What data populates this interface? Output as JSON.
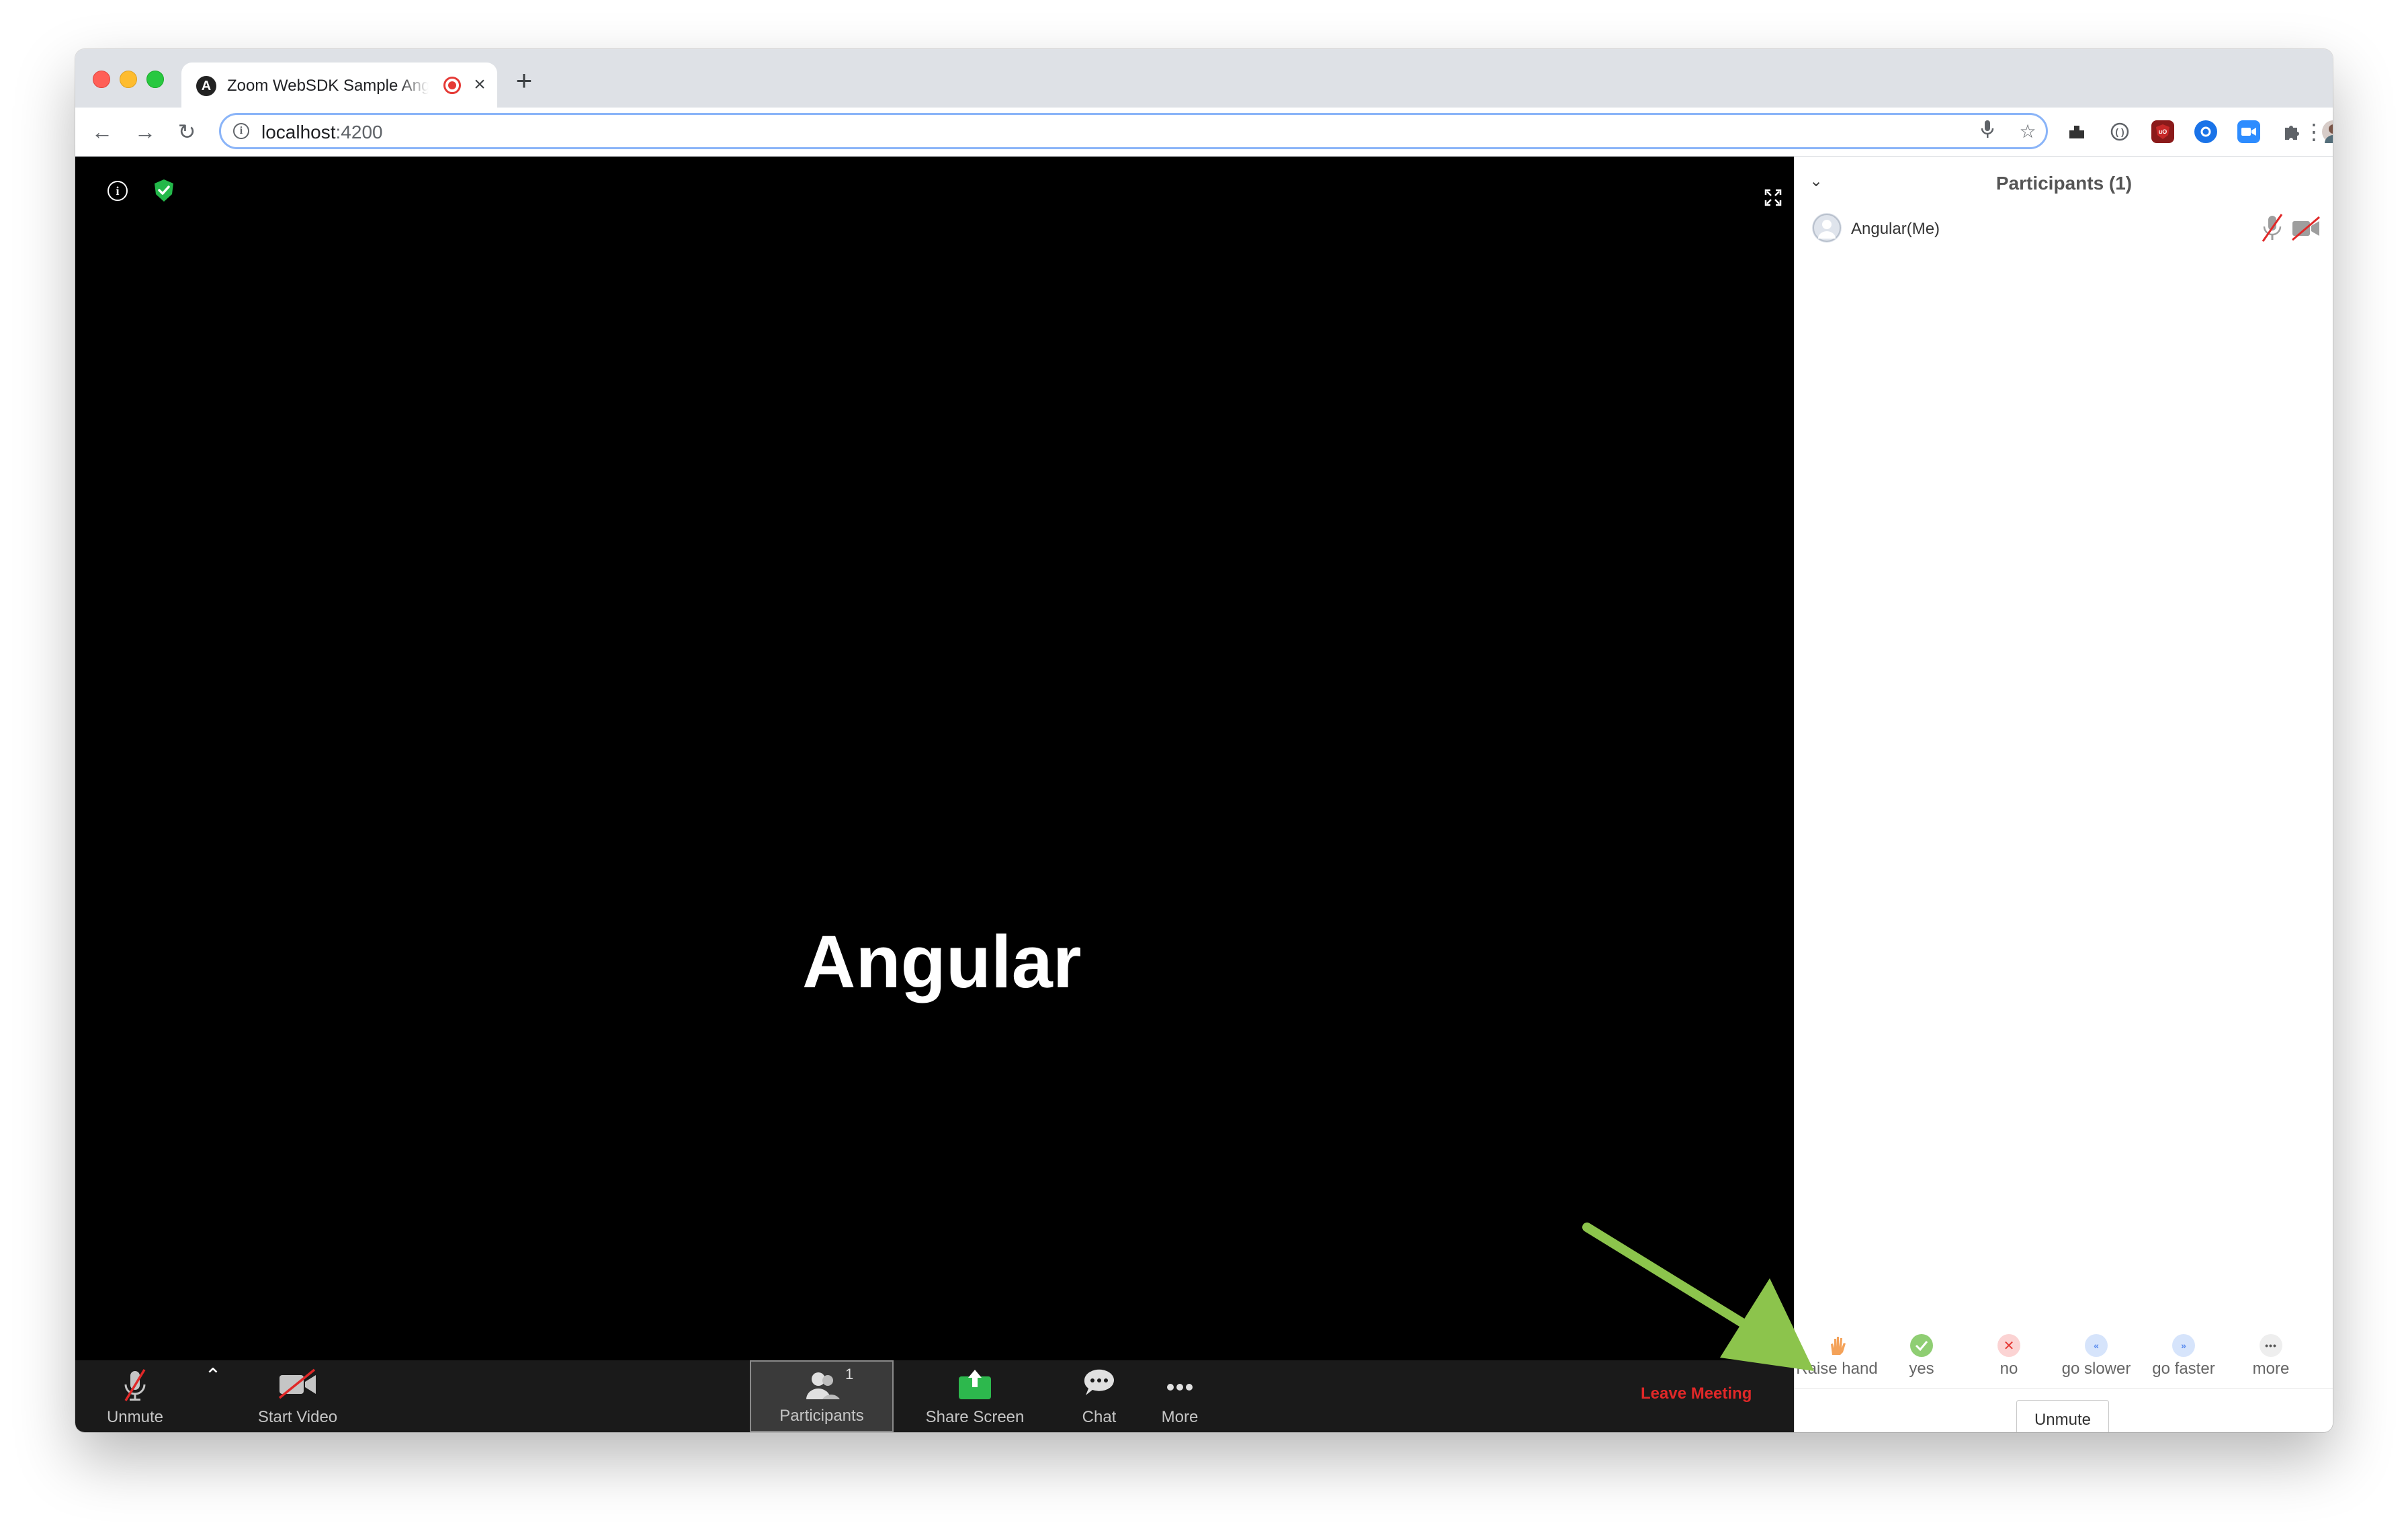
{
  "browser": {
    "tab_title": "Zoom WebSDK Sample Angular",
    "tab_favicon_letter": "A",
    "new_tab_glyph": "+",
    "url_host": "localhost",
    "url_port": ":4200"
  },
  "meeting": {
    "active_speaker": "Angular",
    "controls": {
      "unmute_label": "Unmute",
      "start_video_label": "Start Video",
      "participants_label": "Participants",
      "participants_count": "1",
      "share_screen_label": "Share Screen",
      "chat_label": "Chat",
      "more_label": "More",
      "leave_label": "Leave Meeting"
    }
  },
  "participants_panel": {
    "title": "Participants (1)",
    "participants": [
      {
        "name": "Angular(Me)",
        "muted": true,
        "video_off": true
      }
    ],
    "reactions": [
      {
        "label": "Raise hand",
        "icon": "raise-hand-icon"
      },
      {
        "label": "yes",
        "icon": "check-icon"
      },
      {
        "label": "no",
        "icon": "x-icon"
      },
      {
        "label": "go slower",
        "icon": "go-slower-icon"
      },
      {
        "label": "go faster",
        "icon": "go-faster-icon"
      },
      {
        "label": "more",
        "icon": "more-dots-icon"
      }
    ],
    "unmute_button_label": "Unmute"
  },
  "colors": {
    "leave_red": "#e02828",
    "share_green": "#2db84d",
    "annotation_arrow": "#8cc44c",
    "control_bar": "#1a1a1a",
    "omnibox_focus": "#8ab4f8"
  }
}
